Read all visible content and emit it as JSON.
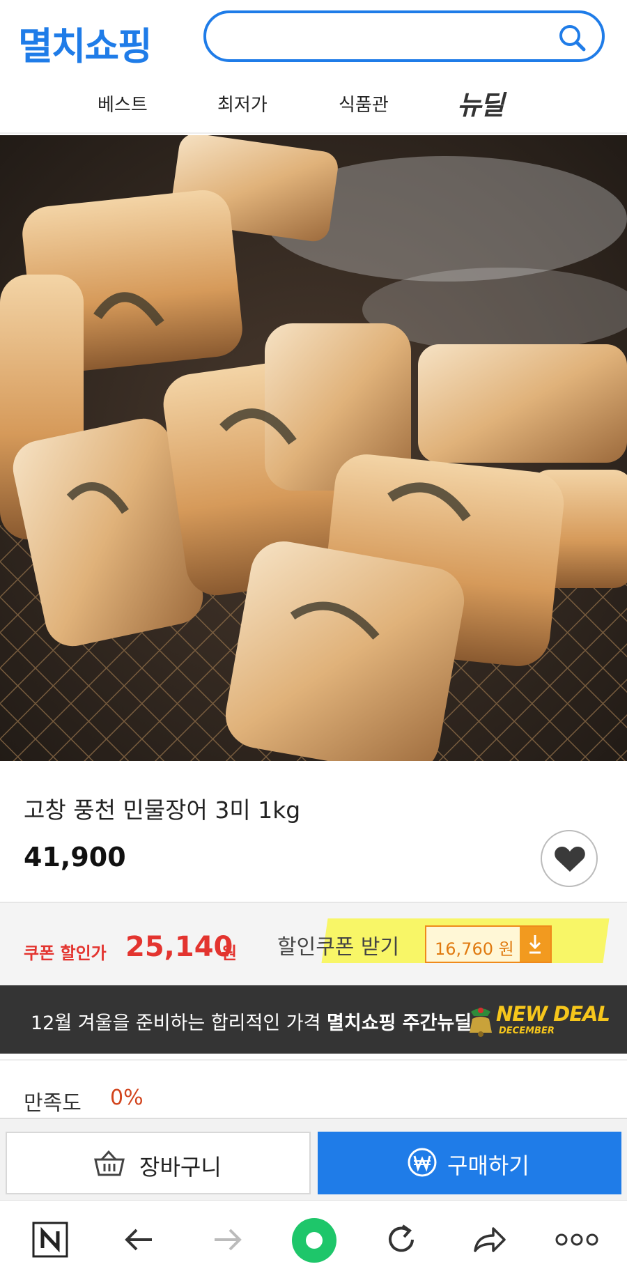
{
  "header": {
    "logo": "멸치쇼핑",
    "search": {
      "placeholder": "",
      "value": ""
    },
    "icons": {
      "search": "search-icon"
    },
    "nav": [
      {
        "label": "베스트"
      },
      {
        "label": "최저가"
      },
      {
        "label": "식품관"
      },
      {
        "label": "뉴딜"
      }
    ]
  },
  "product": {
    "image": "grilled-eel-photo",
    "title": "고창 풍천 민물장어 3미 1kg",
    "price": "41,900",
    "wishlist_icon": "heart-icon"
  },
  "coupon": {
    "label": "쿠폰 할인가",
    "price": "25,140",
    "unit": "원",
    "get_label": "할인쿠폰 받기",
    "box_value": "16,760 원",
    "download_icon": "download-icon"
  },
  "banner": {
    "text_prefix": "12월 겨울을 준비하는 합리적인 가격 ",
    "text_bold": "멸치쇼핑 주간뉴딜",
    "badge_main": "NEW DEAL",
    "badge_sub": "DECEMBER"
  },
  "satisfaction": {
    "label": "만족도",
    "value": "0%"
  },
  "actions": {
    "cart_label": "장바구니",
    "buy_label": "구매하기"
  },
  "browser_bar": {
    "icons": [
      "naver-n-icon",
      "back-arrow-icon",
      "forward-arrow-icon",
      "home-circle-icon",
      "refresh-icon",
      "share-icon",
      "more-icon"
    ]
  },
  "colors": {
    "brand": "#1f7ce8",
    "discount": "#e3342f",
    "highlight": "#f7f55a",
    "coupon_orange": "#f29a1f",
    "banner_bg": "#343434",
    "browser_green": "#1ec66a"
  }
}
